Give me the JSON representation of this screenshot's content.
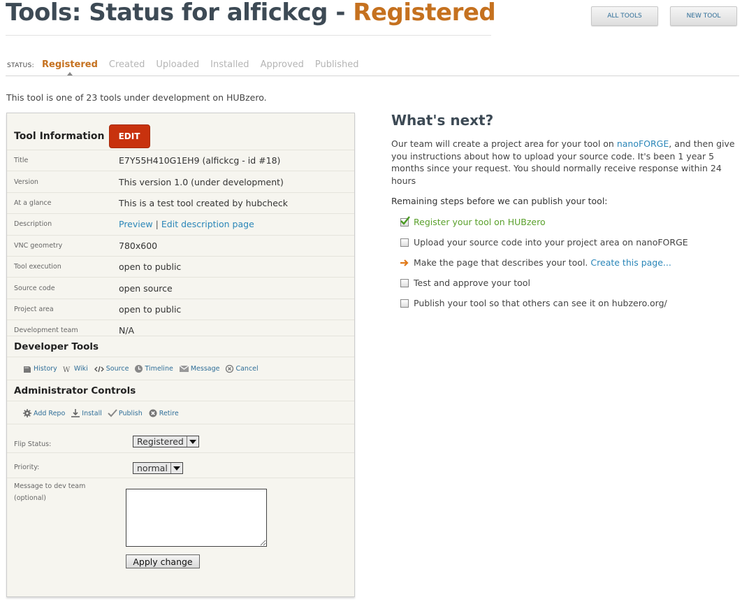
{
  "header": {
    "title_prefix": "Tools: Status for alfickcg - ",
    "title_status": "Registered",
    "all_tools": "ALL TOOLS",
    "new_tool": "NEW TOOL"
  },
  "status_bar": {
    "label": "STATUS:",
    "steps": [
      "Registered",
      "Created",
      "Uploaded",
      "Installed",
      "Approved",
      "Published"
    ],
    "active_index": 0
  },
  "intro": "This tool is one of 23 tools under development on HUBzero.",
  "tool_info": {
    "heading": "Tool Information",
    "edit_label": "EDIT",
    "rows": [
      {
        "label": "Title",
        "value": "E7Y55H410G1EH9 (alfickcg - id #18)"
      },
      {
        "label": "Version",
        "value": "This version 1.0 (under development)"
      },
      {
        "label": "At a glance",
        "value": "This is a test tool created by hubcheck"
      },
      {
        "label": "Description",
        "preview": "Preview",
        "separator": "|",
        "edit_link": "Edit description page"
      },
      {
        "label": "VNC geometry",
        "value": "780x600"
      },
      {
        "label": "Tool execution",
        "value": "open to public"
      },
      {
        "label": "Source code",
        "value": "open source"
      },
      {
        "label": "Project area",
        "value": "open to public"
      },
      {
        "label": "Development team",
        "value": "N/A"
      }
    ]
  },
  "developer_tools": {
    "heading": "Developer Tools",
    "links": [
      {
        "label": "History",
        "icon": "history-icon"
      },
      {
        "label": "Wiki",
        "icon": "wiki-icon"
      },
      {
        "label": "Source",
        "icon": "source-icon"
      },
      {
        "label": "Timeline",
        "icon": "timeline-icon"
      },
      {
        "label": "Message",
        "icon": "message-icon"
      },
      {
        "label": "Cancel",
        "icon": "cancel-icon"
      }
    ]
  },
  "admin_controls": {
    "heading": "Administrator Controls",
    "links": [
      {
        "label": "Add Repo",
        "icon": "gear-icon"
      },
      {
        "label": "Install",
        "icon": "install-icon"
      },
      {
        "label": "Publish",
        "icon": "checkmark-icon"
      },
      {
        "label": "Retire",
        "icon": "close-circle-icon"
      }
    ],
    "flip_status_label": "Flip Status:",
    "flip_status_value": "Registered",
    "priority_label": "Priority:",
    "priority_value": "normal",
    "message_label": "Message to dev team",
    "message_optional": "(optional)",
    "apply_label": "Apply change"
  },
  "whats_next": {
    "heading": "What's next?",
    "para_before": "Our team will create a project area for your tool on ",
    "para_link": "nanoFORGE",
    "para_after": ", and then give you instructions about how to upload your source code. It's been 1 year 5 months since your request. You should normally receive response within 24 hours",
    "steps_heading": "Remaining steps before we can publish your tool:",
    "steps": [
      {
        "text": "Register your tool on HUBzero",
        "state": "done"
      },
      {
        "text": "Upload your source code into your project area on nanoFORGE",
        "state": "todo"
      },
      {
        "text": "Make the page that describes your tool. ",
        "link": "Create this page...",
        "state": "current"
      },
      {
        "text": "Test and approve your tool",
        "state": "todo"
      },
      {
        "text": "Publish your tool so that others can see it on hubzero.org/",
        "state": "todo"
      }
    ]
  },
  "colors": {
    "accent": "#c5711f",
    "link": "#2a86b8",
    "edit": "#c8320e",
    "done": "#5aa02c"
  }
}
